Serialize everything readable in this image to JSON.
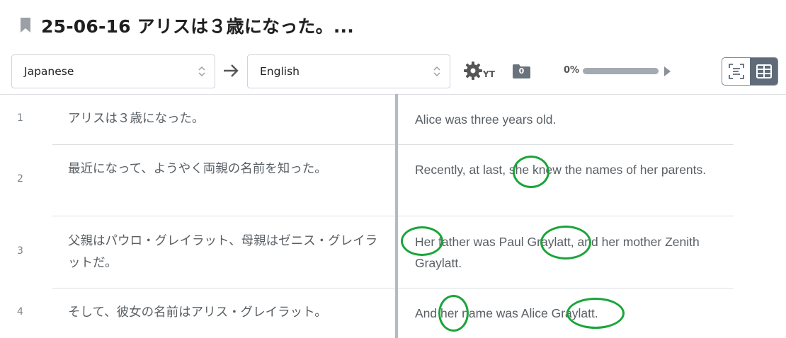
{
  "header": {
    "title": "25-06-16 アリスは３歳になった。..."
  },
  "toolbar": {
    "source_language": "Japanese",
    "target_language": "English",
    "yt_label": "YT",
    "folder_count": "0",
    "progress_text": "0%",
    "progress_value": 0.0
  },
  "rows": [
    {
      "num": "1",
      "source": "アリスは３歳になった。",
      "target": "Alice was three years old."
    },
    {
      "num": "2",
      "source": "最近になって、ようやく両親の名前を知った。",
      "target": "Recently, at last, she knew the names of her parents."
    },
    {
      "num": "3",
      "source": "父親はパウロ・グレイラット、母親はゼニス・グレイラットだ。",
      "target": "Her father was Paul Graylatt, and her mother Zenith Graylatt."
    },
    {
      "num": "4",
      "source": "そして、彼女の名前はアリス・グレイラット。",
      "target": "And her name was Alice Graylatt."
    }
  ],
  "colors": {
    "annotation": "#1aa53a",
    "progress_fill": "#2a8cff",
    "toggle_active": "#5f6b78"
  },
  "icons": [
    "bookmark-icon",
    "chevron-updown-icon",
    "arrow-right-icon",
    "gear-icon",
    "folder-icon",
    "play-icon",
    "text-view-icon",
    "grid-view-icon"
  ]
}
